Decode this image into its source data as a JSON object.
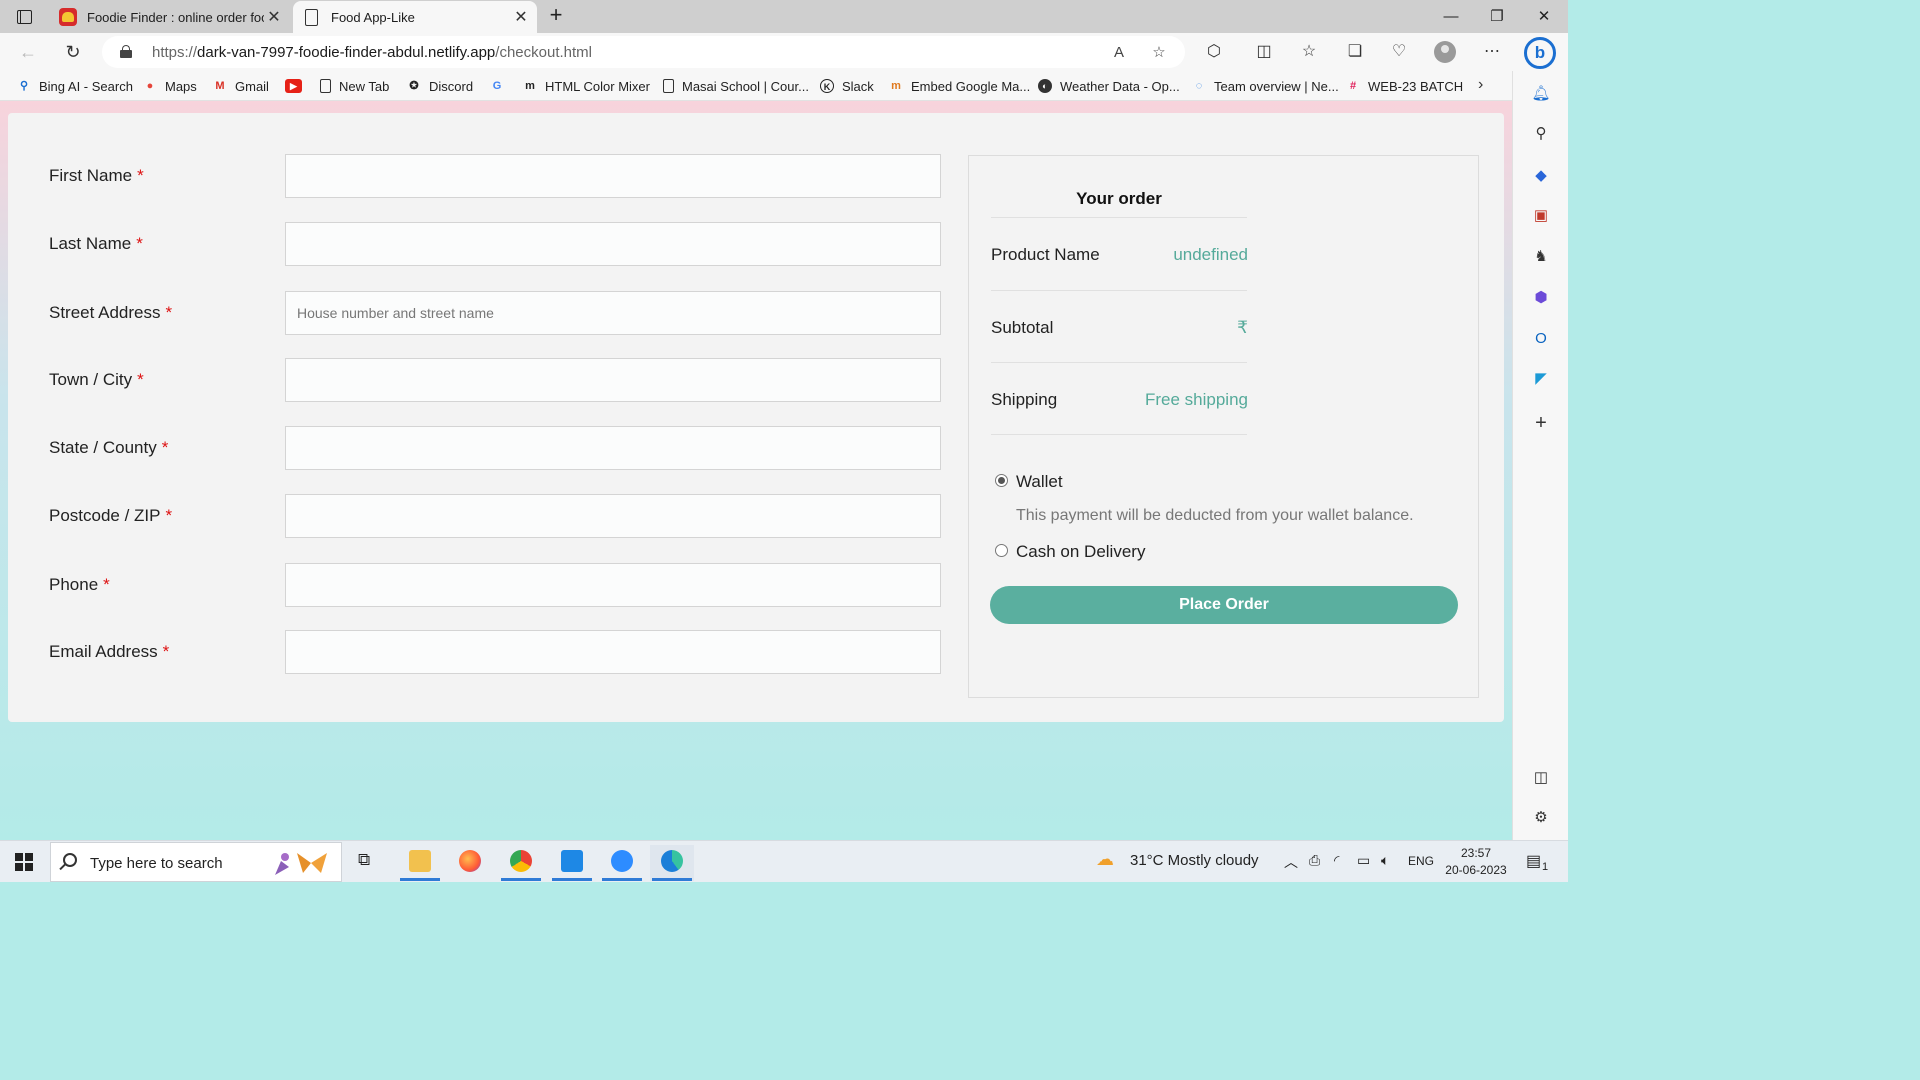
{
  "browser": {
    "tabs": [
      {
        "title": "Foodie Finder : online order food",
        "active": false
      },
      {
        "title": "Food App-Like",
        "active": true
      }
    ],
    "url_prefix": "https://",
    "url_host": "dark-van-7997-foodie-finder-abdul.netlify.app",
    "url_path": "/checkout.html",
    "bookmarks": [
      "Bing AI - Search",
      "Maps",
      "Gmail",
      "",
      "New Tab",
      "Discord",
      "",
      "HTML Color Mixer",
      "Masai School | Cour...",
      "Slack",
      "Embed Google Ma...",
      "Weather Data - Op...",
      "Team overview | Ne...",
      "WEB-23 BATCH"
    ]
  },
  "form": {
    "fields": [
      {
        "label": "First Name",
        "value": "",
        "placeholder": ""
      },
      {
        "label": "Last Name",
        "value": "",
        "placeholder": ""
      },
      {
        "label": "Street Address",
        "value": "",
        "placeholder": "House number and street name"
      },
      {
        "label": "Town / City",
        "value": "",
        "placeholder": ""
      },
      {
        "label": "State / County",
        "value": "",
        "placeholder": ""
      },
      {
        "label": "Postcode / ZIP",
        "value": "",
        "placeholder": ""
      },
      {
        "label": "Phone",
        "value": "",
        "placeholder": ""
      },
      {
        "label": "Email Address",
        "value": "",
        "placeholder": ""
      }
    ],
    "required_mark": "*"
  },
  "order": {
    "title": "Your order",
    "product_label": "Product Name",
    "product_value": "undefined",
    "subtotal_label": "Subtotal",
    "subtotal_value": "₹",
    "shipping_label": "Shipping",
    "shipping_value": "Free shipping",
    "payment_options": [
      {
        "label": "Wallet",
        "selected": true
      },
      {
        "label": "Cash on Delivery",
        "selected": false
      }
    ],
    "wallet_note": "This payment will be deducted from your wallet balance.",
    "place_order_label": "Place Order",
    "accent_color": "#5aaf9f"
  },
  "taskbar": {
    "search_placeholder": "Type here to search",
    "weather": "31°C  Mostly cloudy",
    "language": "ENG",
    "time": "23:57",
    "date": "20-06-2023",
    "notification_count": "1"
  }
}
